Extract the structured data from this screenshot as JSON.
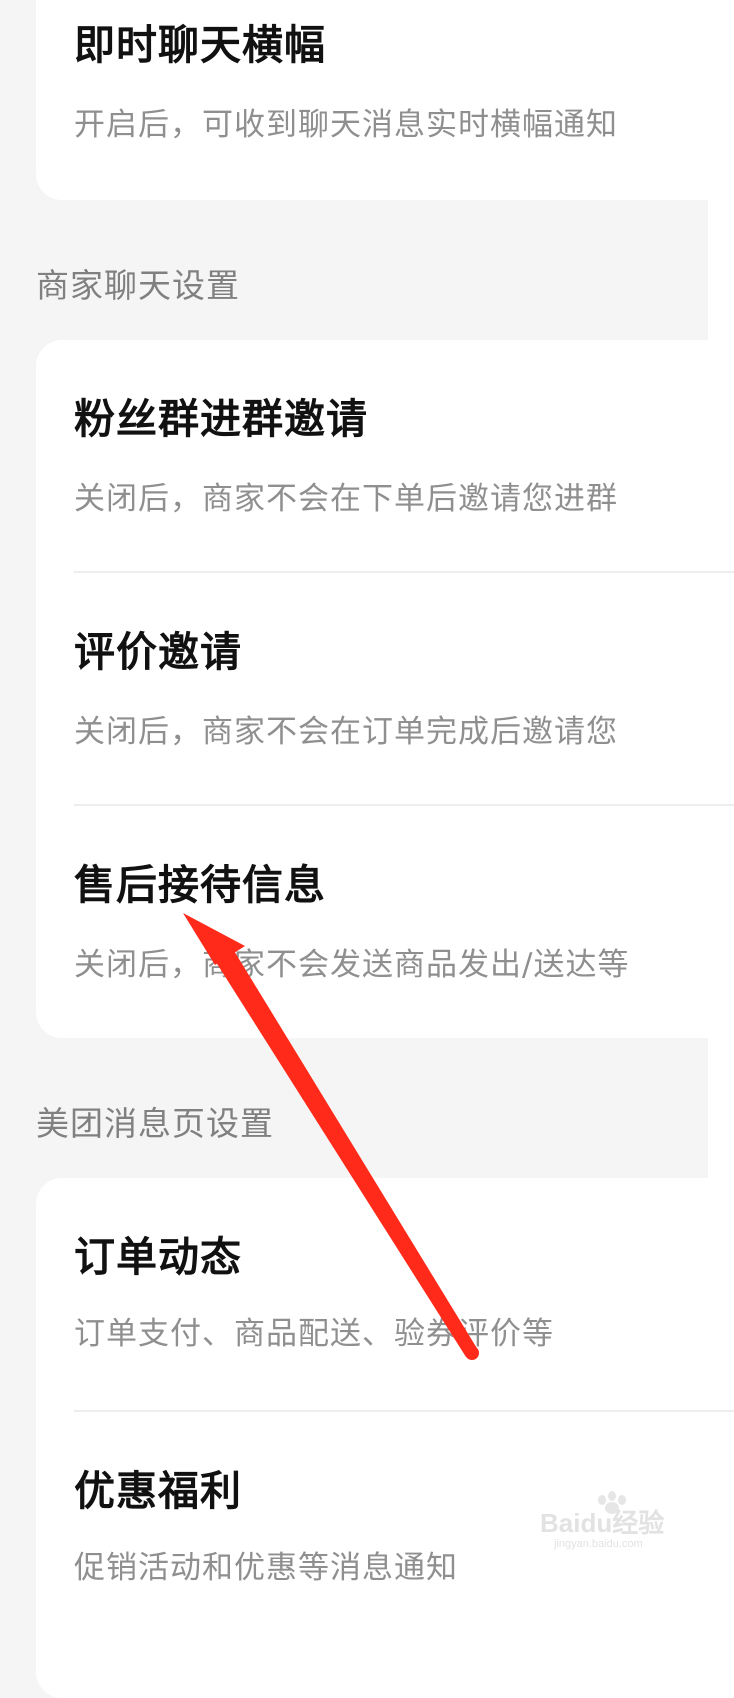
{
  "sections": {
    "notifications": {
      "items": [
        {
          "title": "即时聊天横幅",
          "desc": "开启后，可收到聊天消息实时横幅通知"
        }
      ]
    },
    "merchant_chat": {
      "header": "商家聊天设置",
      "items": [
        {
          "title": "粉丝群进群邀请",
          "desc": "关闭后，商家不会在下单后邀请您进群"
        },
        {
          "title": "评价邀请",
          "desc": "关闭后，商家不会在订单完成后邀请您"
        },
        {
          "title": "售后接待信息",
          "desc": "关闭后，商家不会发送商品发出/送达等"
        }
      ]
    },
    "meituan_message_page": {
      "header": "美团消息页设置",
      "items": [
        {
          "title": "订单动态",
          "desc": "订单支付、商品配送、验券评价等"
        },
        {
          "title": "优惠福利",
          "desc": "促销活动和优惠等消息通知"
        }
      ]
    }
  },
  "annotation": {
    "color": "#ff2a1a"
  },
  "watermark": {
    "text": "Baidu经验",
    "subtext": "jingyan.baidu.com"
  }
}
